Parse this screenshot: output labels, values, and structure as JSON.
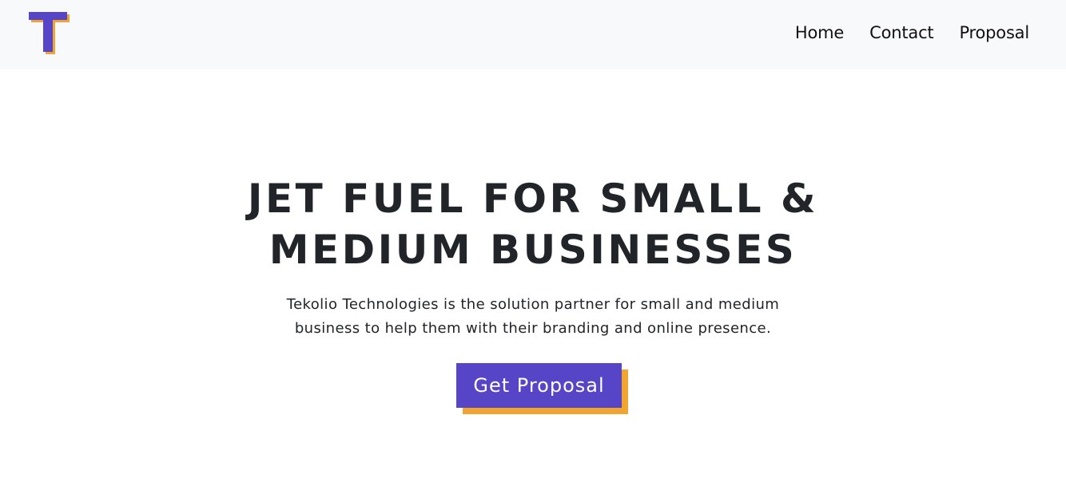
{
  "navbar": {
    "logo_icon": "tekolio-t-logo-icon",
    "links": [
      {
        "label": "Home"
      },
      {
        "label": "Contact"
      },
      {
        "label": "Proposal"
      }
    ]
  },
  "hero": {
    "title_line1": "JET FUEL FOR SMALL &",
    "title_line2": "MEDIUM BUSINESSES",
    "text": "Tekolio Technologies is the solution partner for small and medium business to help them with their branding and online presence.",
    "cta_label": "Get Proposal"
  },
  "colors": {
    "brand_purple": "#5645c6",
    "brand_orange": "#f0a531",
    "navbar_bg": "#f8f9fa",
    "text": "#212529"
  }
}
